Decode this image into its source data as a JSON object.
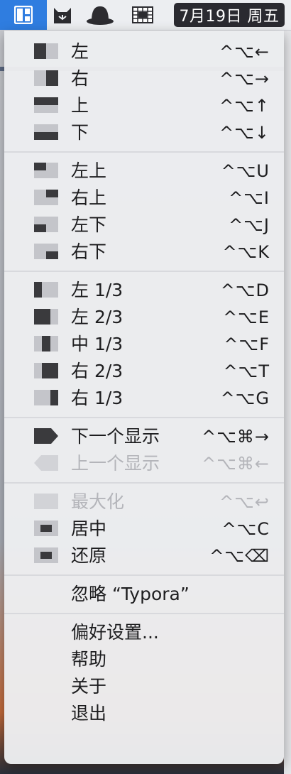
{
  "menubar": {
    "date": "7月19日 周五",
    "icons": [
      "window-layout-icon",
      "share-icon",
      "incognito-hat-icon",
      "grid-icon"
    ]
  },
  "colors": {
    "active": "#2f7de0",
    "light": "#c4c5ca",
    "dark": "#3a3a3d",
    "disabled": "#b4b5ba"
  },
  "menu": {
    "sections": [
      {
        "items": [
          {
            "label": "左",
            "shortcut": "^⌥←",
            "icon": "left-half-icon"
          },
          {
            "label": "右",
            "shortcut": "^⌥→",
            "icon": "right-half-icon"
          },
          {
            "label": "上",
            "shortcut": "^⌥↑",
            "icon": "top-half-icon"
          },
          {
            "label": "下",
            "shortcut": "^⌥↓",
            "icon": "bottom-half-icon"
          }
        ]
      },
      {
        "items": [
          {
            "label": "左上",
            "shortcut": "^⌥U",
            "icon": "top-left-icon"
          },
          {
            "label": "右上",
            "shortcut": "^⌥I",
            "icon": "top-right-icon"
          },
          {
            "label": "左下",
            "shortcut": "^⌥J",
            "icon": "bottom-left-icon"
          },
          {
            "label": "右下",
            "shortcut": "^⌥K",
            "icon": "bottom-right-icon"
          }
        ]
      },
      {
        "items": [
          {
            "label": "左 1/3",
            "shortcut": "^⌥D",
            "icon": "left-third-icon"
          },
          {
            "label": "左 2/3",
            "shortcut": "^⌥E",
            "icon": "left-two-thirds-icon"
          },
          {
            "label": "中 1/3",
            "shortcut": "^⌥F",
            "icon": "center-third-icon"
          },
          {
            "label": "右 2/3",
            "shortcut": "^⌥T",
            "icon": "right-two-thirds-icon"
          },
          {
            "label": "右 1/3",
            "shortcut": "^⌥G",
            "icon": "right-third-icon"
          }
        ]
      },
      {
        "items": [
          {
            "label": "下一个显示",
            "shortcut": "^⌥⌘→",
            "icon": "next-display-icon"
          },
          {
            "label": "上一个显示",
            "shortcut": "^⌥⌘←",
            "icon": "previous-display-icon",
            "disabled": true
          }
        ]
      },
      {
        "items": [
          {
            "label": "最大化",
            "shortcut": "^⌥↩",
            "icon": "maximize-icon",
            "disabled": true
          },
          {
            "label": "居中",
            "shortcut": "^⌥C",
            "icon": "center-icon"
          },
          {
            "label": "还原",
            "shortcut": "^⌥⌫",
            "icon": "restore-icon"
          }
        ]
      },
      {
        "items": [
          {
            "label": "忽略 “Typora”"
          }
        ]
      },
      {
        "items": [
          {
            "label": "偏好设置..."
          },
          {
            "label": "帮助"
          },
          {
            "label": "关于"
          },
          {
            "label": "退出"
          }
        ]
      }
    ]
  }
}
